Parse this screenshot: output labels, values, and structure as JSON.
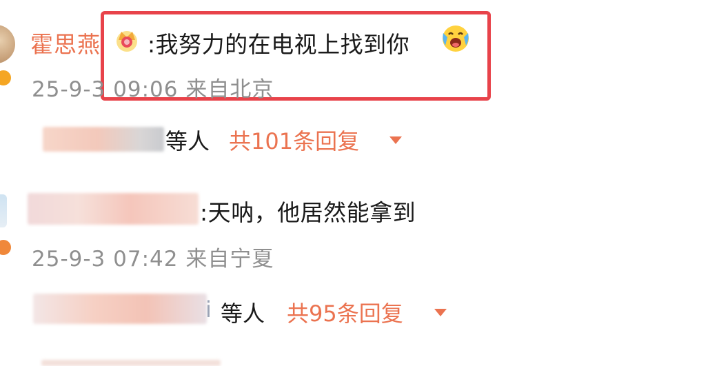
{
  "comment1": {
    "username": "霍思燕",
    "text": ":我努力的在电视上找到你",
    "date": "25-9-3",
    "time": "09:06",
    "location": "来自北京",
    "reply_who": "等人",
    "reply_count": "共101条回复"
  },
  "comment2": {
    "text": ":天呐，他居然能拿到",
    "date": "25-9-3",
    "time": "07:42",
    "location": "来自宁夏",
    "reply_who_suffix": "i",
    "reply_who": "等人",
    "reply_count": "共95条回复"
  },
  "colors": {
    "accent": "#eb7350",
    "highlight": "#e8434a",
    "meta": "#8f8f8f",
    "text": "#1a1a1a"
  }
}
